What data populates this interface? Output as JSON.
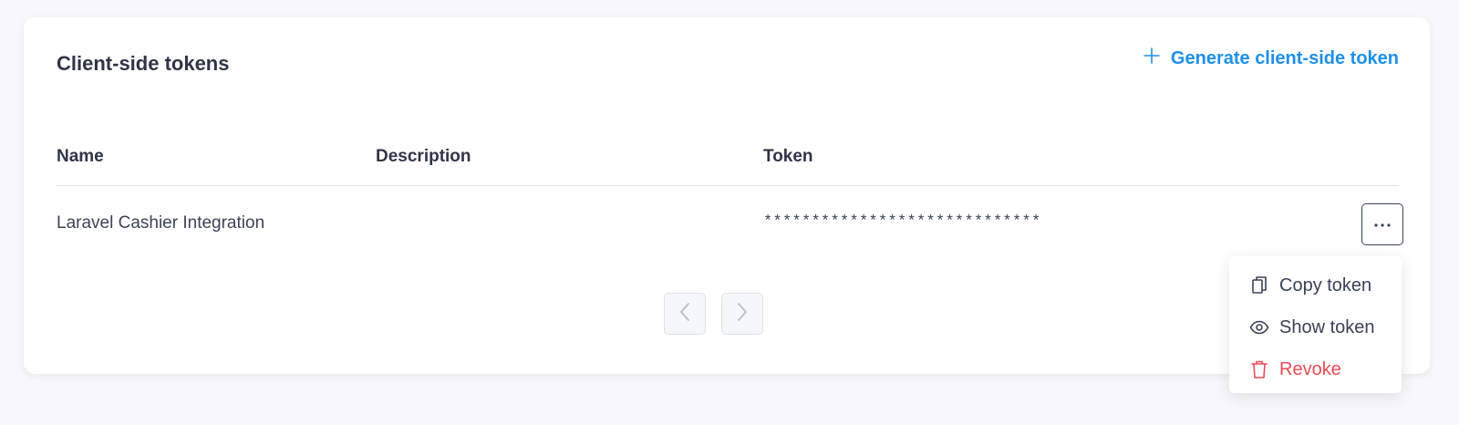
{
  "card": {
    "title": "Client-side tokens",
    "generate_label": "Generate client-side token"
  },
  "table": {
    "columns": [
      "Name",
      "Description",
      "Token"
    ],
    "rows": [
      {
        "name": "Laravel Cashier Integration",
        "description": "",
        "token": "*****************************"
      }
    ]
  },
  "menu": {
    "items": [
      {
        "label": "Copy token",
        "icon": "copy-icon"
      },
      {
        "label": "Show token",
        "icon": "eye-icon"
      },
      {
        "label": "Revoke",
        "icon": "trash-icon"
      }
    ]
  },
  "colors": {
    "accent": "#1e90ea",
    "danger": "#ec4a55",
    "text": "#2f3547"
  }
}
